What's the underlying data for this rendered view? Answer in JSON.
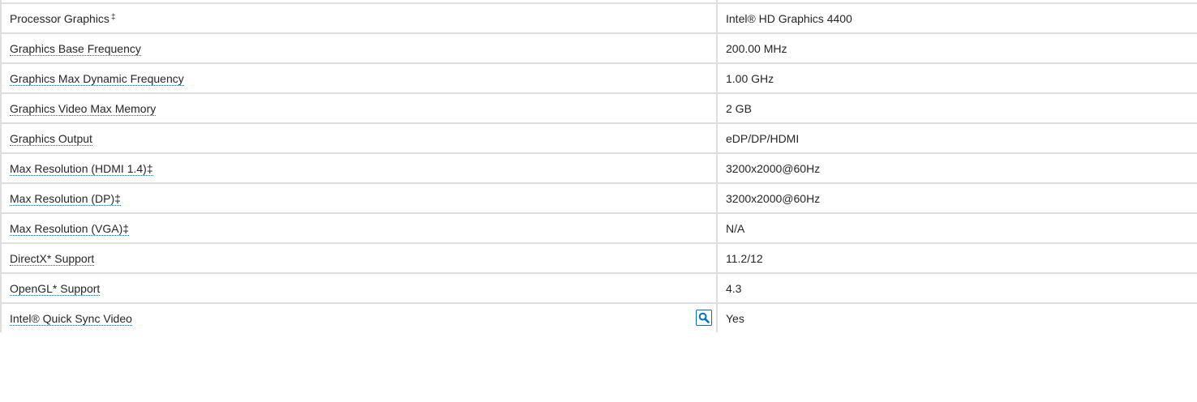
{
  "specs": [
    {
      "label": "Processor Graphics",
      "label_sup": "‡",
      "value": "Intel® HD Graphics 4400"
    },
    {
      "label": "Graphics Base Frequency",
      "value": "200.00 MHz"
    },
    {
      "label": "Graphics Max Dynamic Frequency",
      "value": "1.00 GHz"
    },
    {
      "label": "Graphics Video Max Memory",
      "value": "2 GB"
    },
    {
      "label": "Graphics Output",
      "value": "eDP/DP/HDMI"
    },
    {
      "label": "Max Resolution (HDMI 1.4)‡",
      "value": "3200x2000@60Hz"
    },
    {
      "label": "Max Resolution (DP)‡",
      "value": "3200x2000@60Hz"
    },
    {
      "label": "Max Resolution (VGA)‡",
      "value": "N/A"
    },
    {
      "label": "DirectX* Support",
      "value": "11.2/12"
    },
    {
      "label": "OpenGL* Support",
      "value": "4.3"
    },
    {
      "label": "Intel® Quick Sync Video",
      "value": "Yes",
      "icon": "search-icon"
    }
  ],
  "colors": {
    "border": "#dedede",
    "text": "#262626",
    "accent": "#0071c5"
  }
}
